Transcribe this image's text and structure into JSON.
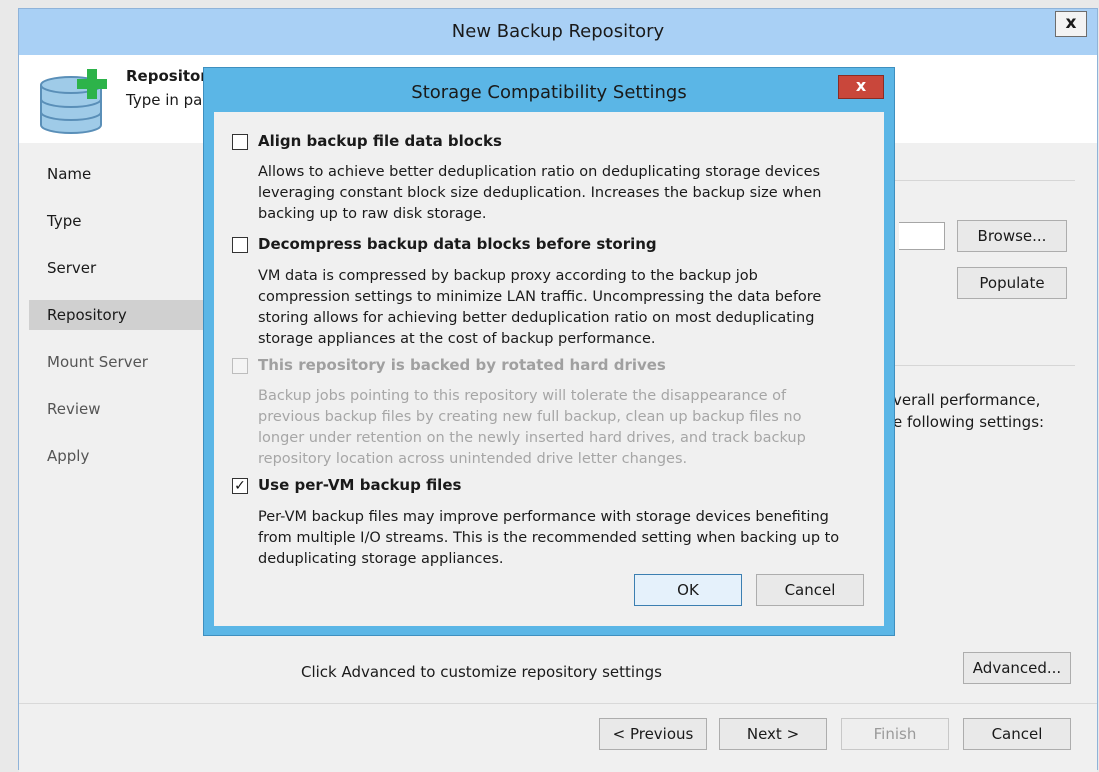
{
  "outer": {
    "title": "New Backup Repository",
    "close_label": "x",
    "header_title": "Repository",
    "header_subtitle": "Type in pa",
    "nav": [
      "Name",
      "Type",
      "Server",
      "Repository",
      "Mount Server",
      "Review",
      "Apply"
    ],
    "active_nav": "Repository",
    "browse_label": "Browse...",
    "populate_label": "Populate",
    "partial_line_1": "verall performance,",
    "partial_line_2": "e following settings:",
    "advanced_hint": "Click Advanced to customize repository settings",
    "advanced_label": "Advanced...",
    "previous_label": "< Previous",
    "next_label": "Next >",
    "finish_label": "Finish",
    "cancel_label": "Cancel"
  },
  "modal": {
    "title": "Storage Compatibility Settings",
    "close_label": "x",
    "options": [
      {
        "label": "Align backup file data blocks",
        "checked": false,
        "enabled": true,
        "desc_lines": [
          "Allows to achieve better deduplication ratio on deduplicating storage devices",
          "leveraging constant block size deduplication. Increases the backup size when",
          "backing up to raw disk storage."
        ]
      },
      {
        "label": "Decompress backup data blocks before storing",
        "checked": false,
        "enabled": true,
        "desc_lines": [
          "VM data is compressed by backup proxy according to the backup job",
          "compression settings to minimize LAN traffic. Uncompressing the data before",
          "storing allows for achieving better deduplication ratio on most deduplicating",
          "storage appliances at the cost of backup performance."
        ]
      },
      {
        "label": "This repository is backed by rotated hard drives",
        "checked": false,
        "enabled": false,
        "desc_lines": [
          "Backup jobs pointing to this repository will tolerate the disappearance of",
          "previous backup files by creating new full backup, clean up backup files no",
          "longer under retention on the newly inserted hard drives, and track backup",
          "repository location across unintended drive letter changes."
        ]
      },
      {
        "label": "Use per-VM backup files",
        "checked": true,
        "enabled": true,
        "desc_lines": [
          "Per-VM backup files may improve performance with storage devices benefiting",
          "from multiple I/O streams. This is the recommended setting when backing up to",
          "deduplicating storage appliances."
        ]
      }
    ],
    "ok_label": "OK",
    "cancel_label": "Cancel",
    "check_glyph": "✓"
  },
  "colors": {
    "modal_frame": "#5bb6e6",
    "outer_titlebar": "#a9d0f5",
    "close_red": "#c9473b",
    "plus_green": "#2db34a",
    "db_blue": "#9fcbe8"
  }
}
